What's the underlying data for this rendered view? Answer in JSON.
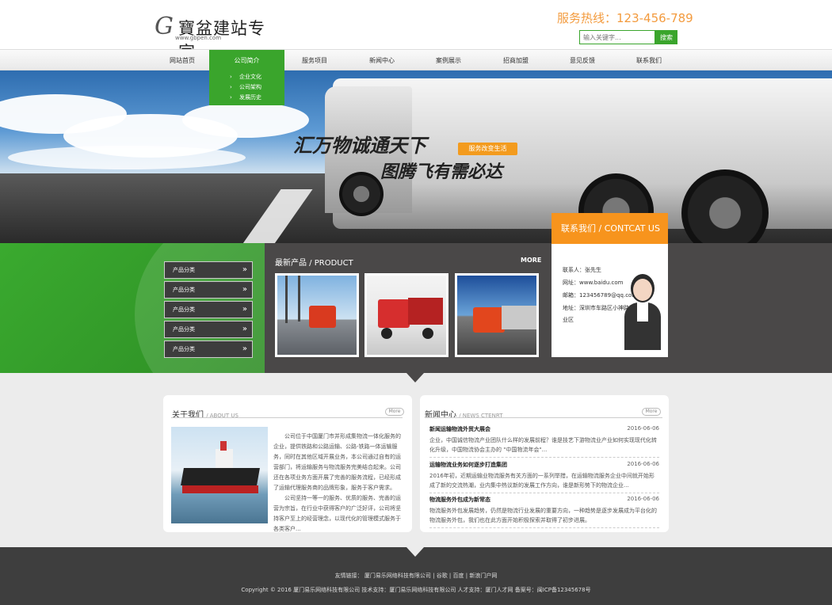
{
  "header": {
    "logo_g": "G",
    "logo_text": "寶盆建站专家",
    "logo_url": "www.gbpen.com",
    "hotline": "服务热线：123-456-789",
    "search_placeholder": "输入关键字...",
    "search_button": "搜索"
  },
  "nav": {
    "items": [
      "网站首页",
      "公司简介",
      "服务项目",
      "新闻中心",
      "案例展示",
      "招商加盟",
      "意见反馈",
      "联系我们"
    ],
    "active_index": 1,
    "dropdown": [
      "企业文化",
      "公司架构",
      "发展历史"
    ]
  },
  "banner": {
    "slogan_line1": "汇万物诚通天下",
    "slogan_line2": "图腾飞有需必达",
    "badge": "服务改变生活"
  },
  "categories": [
    "产品分类",
    "产品分类",
    "产品分类",
    "产品分类",
    "产品分类"
  ],
  "products": {
    "title": "最新产品 / PRODUCT",
    "more": "MORE"
  },
  "contact": {
    "title": "联系我们 / CONTCAT US",
    "person": "联系人：张先生",
    "website": "网址：www.baidu.com",
    "email": "邮箱：123456789@qq.com",
    "address_line1": "地址：深圳市车路区小神路汇总工",
    "address_line2": "业区"
  },
  "about": {
    "title": "关于我们",
    "subtitle": "/ ABOUT US",
    "more": "More",
    "paragraph1": "公司位于中国厦门市并形成集物流一体化服务的企业，提供铁路和公路运输、公路-铁路一体运输服务，同时在其他区域开展业务，本公司通过自有的运营部门，将运输服务与物流服务完美结合起来。公司还在各项业务方面开展了完善的服务流程，已经形成了运输代理服务商的品牌形象，服务于客户需求。",
    "paragraph2": "公司坚持一等一的服务、优质的服务、完善的运营为宗旨，在行业中获得客户的广泛好评，公司将坚持客户至上的经营理念，以现代化的管理模式服务于各类客户..."
  },
  "news": {
    "title": "新闻中心",
    "subtitle": "/ NEWS CTENRT",
    "more": "More",
    "items": [
      {
        "title": "新闻运输物流外贸大展会",
        "date": "2016-06-06",
        "body": "企业，中国诚信物流产业团队什么样的发展前程？谁是技艺下游物流业产业如何实现现代化转化升级，中国物流协会主办的 \"中国物流年会\"..."
      },
      {
        "title": "运输物流业务如何逐步打造集团",
        "date": "2016-06-06",
        "body": "2016年初，近期运输业物流服务有关方面的一系列举措，在运输物流服务企业中间就开始形成了新的交流热潮，业内集中热议新的发展工作方向，谁是新形势下的物流企业..."
      },
      {
        "title": "物流服务外包成为新常态",
        "date": "2016-06-06",
        "body": "物流服务外包发展趋势，仍然是物流行业发展的重要方向，一种趋势是逐步发展成为平台化的物流服务外包，我们也在此方面开始积极探索并取得了初步进展。"
      }
    ]
  },
  "footer": {
    "links": "友情链接：  厦门易乐网络科技有限公司  |  谷歌  |  百度  |  新浪门户网",
    "copyright": "Copyright © 2016 厦门易乐网络科技有限公司 技术支持：厦门易乐网络科技有限公司 人才支持：厦门人才网 备案号：闽ICP备12345678号"
  }
}
